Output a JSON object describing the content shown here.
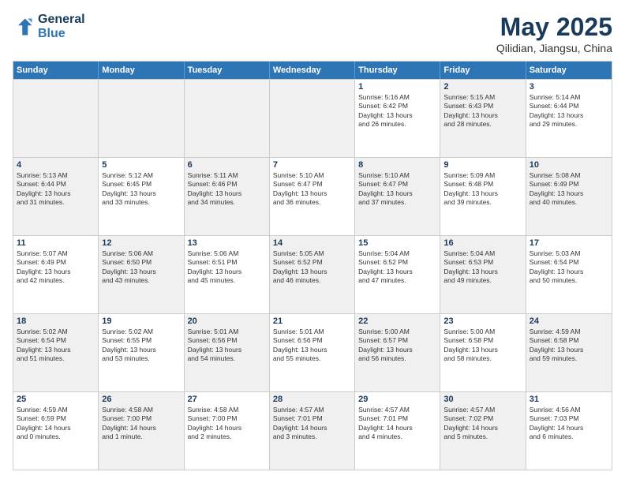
{
  "header": {
    "logo_line1": "General",
    "logo_line2": "Blue",
    "main_title": "May 2025",
    "subtitle": "Qilidian, Jiangsu, China"
  },
  "days": [
    "Sunday",
    "Monday",
    "Tuesday",
    "Wednesday",
    "Thursday",
    "Friday",
    "Saturday"
  ],
  "rows": [
    [
      {
        "day": "",
        "text": "",
        "shaded": true
      },
      {
        "day": "",
        "text": "",
        "shaded": true
      },
      {
        "day": "",
        "text": "",
        "shaded": true
      },
      {
        "day": "",
        "text": "",
        "shaded": true
      },
      {
        "day": "1",
        "text": "Sunrise: 5:16 AM\nSunset: 6:42 PM\nDaylight: 13 hours\nand 26 minutes.",
        "shaded": false
      },
      {
        "day": "2",
        "text": "Sunrise: 5:15 AM\nSunset: 6:43 PM\nDaylight: 13 hours\nand 28 minutes.",
        "shaded": true
      },
      {
        "day": "3",
        "text": "Sunrise: 5:14 AM\nSunset: 6:44 PM\nDaylight: 13 hours\nand 29 minutes.",
        "shaded": false
      }
    ],
    [
      {
        "day": "4",
        "text": "Sunrise: 5:13 AM\nSunset: 6:44 PM\nDaylight: 13 hours\nand 31 minutes.",
        "shaded": true
      },
      {
        "day": "5",
        "text": "Sunrise: 5:12 AM\nSunset: 6:45 PM\nDaylight: 13 hours\nand 33 minutes.",
        "shaded": false
      },
      {
        "day": "6",
        "text": "Sunrise: 5:11 AM\nSunset: 6:46 PM\nDaylight: 13 hours\nand 34 minutes.",
        "shaded": true
      },
      {
        "day": "7",
        "text": "Sunrise: 5:10 AM\nSunset: 6:47 PM\nDaylight: 13 hours\nand 36 minutes.",
        "shaded": false
      },
      {
        "day": "8",
        "text": "Sunrise: 5:10 AM\nSunset: 6:47 PM\nDaylight: 13 hours\nand 37 minutes.",
        "shaded": true
      },
      {
        "day": "9",
        "text": "Sunrise: 5:09 AM\nSunset: 6:48 PM\nDaylight: 13 hours\nand 39 minutes.",
        "shaded": false
      },
      {
        "day": "10",
        "text": "Sunrise: 5:08 AM\nSunset: 6:49 PM\nDaylight: 13 hours\nand 40 minutes.",
        "shaded": true
      }
    ],
    [
      {
        "day": "11",
        "text": "Sunrise: 5:07 AM\nSunset: 6:49 PM\nDaylight: 13 hours\nand 42 minutes.",
        "shaded": false
      },
      {
        "day": "12",
        "text": "Sunrise: 5:06 AM\nSunset: 6:50 PM\nDaylight: 13 hours\nand 43 minutes.",
        "shaded": true
      },
      {
        "day": "13",
        "text": "Sunrise: 5:06 AM\nSunset: 6:51 PM\nDaylight: 13 hours\nand 45 minutes.",
        "shaded": false
      },
      {
        "day": "14",
        "text": "Sunrise: 5:05 AM\nSunset: 6:52 PM\nDaylight: 13 hours\nand 46 minutes.",
        "shaded": true
      },
      {
        "day": "15",
        "text": "Sunrise: 5:04 AM\nSunset: 6:52 PM\nDaylight: 13 hours\nand 47 minutes.",
        "shaded": false
      },
      {
        "day": "16",
        "text": "Sunrise: 5:04 AM\nSunset: 6:53 PM\nDaylight: 13 hours\nand 49 minutes.",
        "shaded": true
      },
      {
        "day": "17",
        "text": "Sunrise: 5:03 AM\nSunset: 6:54 PM\nDaylight: 13 hours\nand 50 minutes.",
        "shaded": false
      }
    ],
    [
      {
        "day": "18",
        "text": "Sunrise: 5:02 AM\nSunset: 6:54 PM\nDaylight: 13 hours\nand 51 minutes.",
        "shaded": true
      },
      {
        "day": "19",
        "text": "Sunrise: 5:02 AM\nSunset: 6:55 PM\nDaylight: 13 hours\nand 53 minutes.",
        "shaded": false
      },
      {
        "day": "20",
        "text": "Sunrise: 5:01 AM\nSunset: 6:56 PM\nDaylight: 13 hours\nand 54 minutes.",
        "shaded": true
      },
      {
        "day": "21",
        "text": "Sunrise: 5:01 AM\nSunset: 6:56 PM\nDaylight: 13 hours\nand 55 minutes.",
        "shaded": false
      },
      {
        "day": "22",
        "text": "Sunrise: 5:00 AM\nSunset: 6:57 PM\nDaylight: 13 hours\nand 56 minutes.",
        "shaded": true
      },
      {
        "day": "23",
        "text": "Sunrise: 5:00 AM\nSunset: 6:58 PM\nDaylight: 13 hours\nand 58 minutes.",
        "shaded": false
      },
      {
        "day": "24",
        "text": "Sunrise: 4:59 AM\nSunset: 6:58 PM\nDaylight: 13 hours\nand 59 minutes.",
        "shaded": true
      }
    ],
    [
      {
        "day": "25",
        "text": "Sunrise: 4:59 AM\nSunset: 6:59 PM\nDaylight: 14 hours\nand 0 minutes.",
        "shaded": false
      },
      {
        "day": "26",
        "text": "Sunrise: 4:58 AM\nSunset: 7:00 PM\nDaylight: 14 hours\nand 1 minute.",
        "shaded": true
      },
      {
        "day": "27",
        "text": "Sunrise: 4:58 AM\nSunset: 7:00 PM\nDaylight: 14 hours\nand 2 minutes.",
        "shaded": false
      },
      {
        "day": "28",
        "text": "Sunrise: 4:57 AM\nSunset: 7:01 PM\nDaylight: 14 hours\nand 3 minutes.",
        "shaded": true
      },
      {
        "day": "29",
        "text": "Sunrise: 4:57 AM\nSunset: 7:01 PM\nDaylight: 14 hours\nand 4 minutes.",
        "shaded": false
      },
      {
        "day": "30",
        "text": "Sunrise: 4:57 AM\nSunset: 7:02 PM\nDaylight: 14 hours\nand 5 minutes.",
        "shaded": true
      },
      {
        "day": "31",
        "text": "Sunrise: 4:56 AM\nSunset: 7:03 PM\nDaylight: 14 hours\nand 6 minutes.",
        "shaded": false
      }
    ]
  ]
}
